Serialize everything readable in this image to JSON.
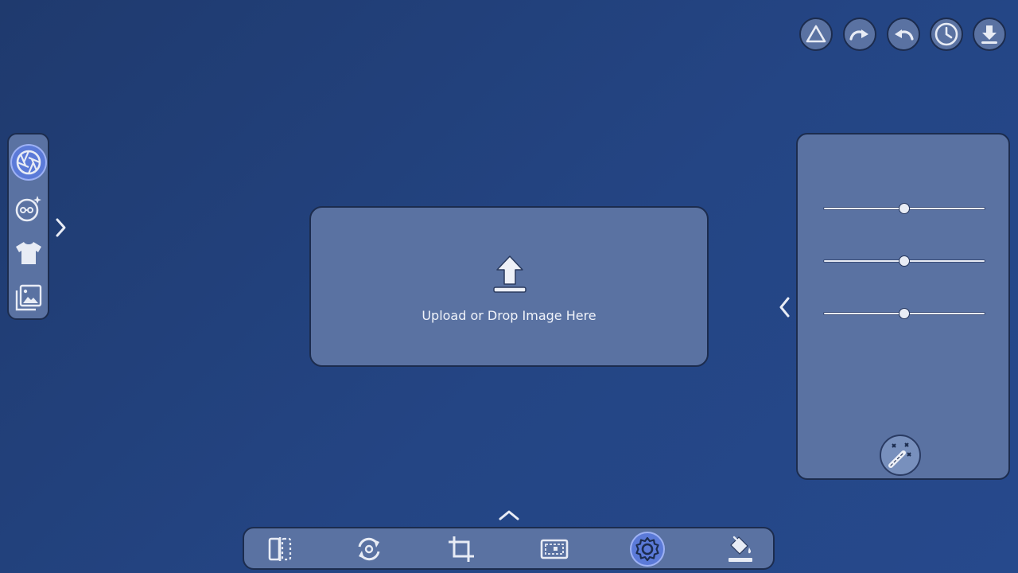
{
  "top_actions": [
    {
      "name": "triangle-icon"
    },
    {
      "name": "redo-icon"
    },
    {
      "name": "undo-icon"
    },
    {
      "name": "history-clock-icon"
    },
    {
      "name": "download-icon"
    }
  ],
  "left_toolbar": {
    "tools": [
      {
        "name": "aperture-icon",
        "active": true
      },
      {
        "name": "face-retouch-icon",
        "active": false
      },
      {
        "name": "tshirt-icon",
        "active": false
      },
      {
        "name": "gallery-icon",
        "active": false
      }
    ],
    "expand_icon": "chevron-right-icon"
  },
  "upload": {
    "label": "Upload or Drop Image Here",
    "icon": "upload-arrow-icon"
  },
  "right_panel": {
    "collapse_icon": "chevron-left-icon",
    "sliders": [
      {
        "value": 0.5
      },
      {
        "value": 0.5
      },
      {
        "value": 0.5
      }
    ],
    "magic_button_icon": "magic-wand-icon"
  },
  "bottom_toolbar": {
    "expand_icon": "chevron-up-icon",
    "tools": [
      {
        "name": "compare-icon",
        "active": false
      },
      {
        "name": "rotate-icon",
        "active": false
      },
      {
        "name": "crop-icon",
        "active": false
      },
      {
        "name": "frame-icon",
        "active": false
      },
      {
        "name": "adjust-gear-icon",
        "active": true
      },
      {
        "name": "fill-bucket-icon",
        "active": false
      }
    ]
  },
  "colors": {
    "background_start": "#1f3a6e",
    "background_end": "#26498c",
    "panel": "#5a72a2",
    "panel_border": "#1c2c4e",
    "active_tool": "#5b7ad8",
    "icon": "#e8ecf5"
  }
}
